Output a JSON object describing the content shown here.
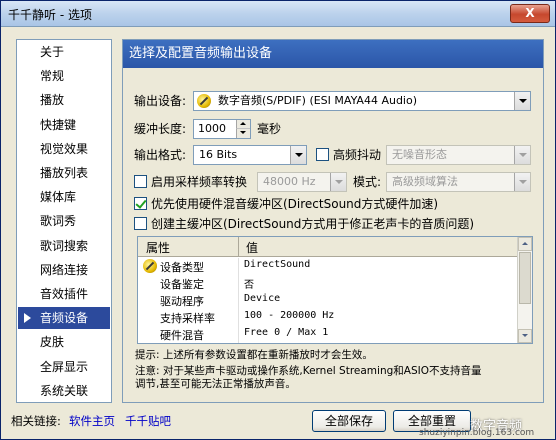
{
  "window": {
    "title": "千千静听 - 选项",
    "close_label": "X"
  },
  "sidebar": {
    "items": [
      {
        "label": "关于"
      },
      {
        "label": "常规"
      },
      {
        "label": "播放"
      },
      {
        "label": "快捷键"
      },
      {
        "label": "视觉效果"
      },
      {
        "label": "播放列表"
      },
      {
        "label": "媒体库"
      },
      {
        "label": "歌词秀"
      },
      {
        "label": "歌词搜索"
      },
      {
        "label": "网络连接"
      },
      {
        "label": "音效插件"
      },
      {
        "label": "音频设备"
      },
      {
        "label": "皮肤"
      },
      {
        "label": "全屏显示"
      },
      {
        "label": "系统关联"
      }
    ],
    "active_index": 11
  },
  "panel": {
    "header": "选择及配置音频输出设备",
    "output_device": {
      "label": "输出设备:",
      "value": "数字音频(S/PDIF) (ESI MAYA44 Audio)"
    },
    "buffer": {
      "label": "缓冲长度:",
      "value": "1000",
      "unit": "毫秒"
    },
    "format": {
      "label": "输出格式:",
      "value": "16 Bits"
    },
    "dither": {
      "label": "高频抖动",
      "checked": false,
      "value": "无噪音形态"
    },
    "resample": {
      "label": "启用采样频率转换",
      "checked": false,
      "value": "48000 Hz"
    },
    "mode": {
      "label": "模式:",
      "value": "高级频域算法"
    },
    "hw_mix": {
      "label": "优先使用硬件混音缓冲区(DirectSound方式硬件加速)",
      "checked": true
    },
    "primary_buffer": {
      "label": "创建主缓冲区(DirectSound方式用于修正老声卡的音质问题)",
      "checked": false
    },
    "properties": {
      "header_key": "属性",
      "header_value": "值",
      "rows": [
        {
          "key": "设备类型",
          "value": "DirectSound"
        },
        {
          "key": "设备鉴定",
          "value": "否"
        },
        {
          "key": "驱动程序",
          "value": "Device"
        },
        {
          "key": "支持采样率",
          "value": "100 - 200000 Hz"
        },
        {
          "key": "硬件混音",
          "value": "Free 0 / Max 1"
        }
      ]
    },
    "hint": "提示: 上述所有参数设置都在重新播放时才会生效。",
    "note_line1": "注意: 对于某些声卡驱动或操作系统,Kernel Streaming和ASIO不支持音量",
    "note_line2": "调节,甚至可能无法正常播放声音。"
  },
  "footer": {
    "related_label": "相关链接:",
    "link1": "软件主页",
    "link2": "千千贴吧",
    "save_button": "全部保存",
    "reset_button": "全部重置",
    "watermark": "数字音频",
    "watermark_url": "shuziyinpin.blog.163.com"
  }
}
